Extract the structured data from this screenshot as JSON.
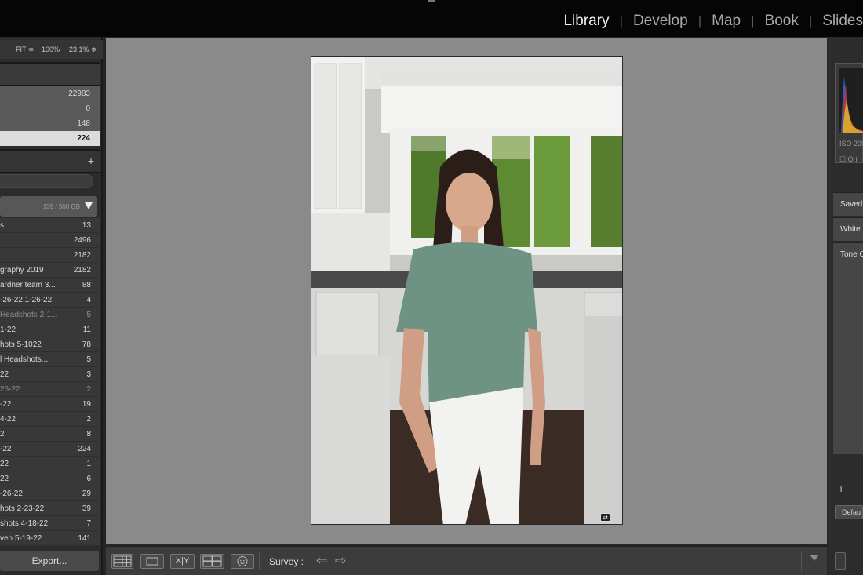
{
  "modules": {
    "items": [
      "Library",
      "Develop",
      "Map",
      "Book",
      "Slides"
    ],
    "active": "Library"
  },
  "navigator": {
    "fit": "FIT ≑",
    "zoom_100": "100%",
    "zoom_custom": "23.1% ≑"
  },
  "catalog": {
    "rows": [
      {
        "count": "22983"
      },
      {
        "count": "0"
      },
      {
        "count": "148"
      },
      {
        "count": "224",
        "selected": true
      }
    ]
  },
  "folders": {
    "add_icon": "+",
    "volume": {
      "size": "139 / 500 GB"
    },
    "rows": [
      {
        "name": "s",
        "count": "13"
      },
      {
        "name": "",
        "count": "2496"
      },
      {
        "name": "",
        "count": "2182"
      },
      {
        "name": "graphy 2019",
        "count": "2182"
      },
      {
        "name": "ardner team 3...",
        "count": "88"
      },
      {
        "name": "-26-22 1-26-22",
        "count": "4"
      },
      {
        "name": "Headshots 2-1...",
        "count": "5",
        "dim": true
      },
      {
        "name": "1-22",
        "count": "11"
      },
      {
        "name": "hots 5-1022",
        "count": "78"
      },
      {
        "name": "l Headshots...",
        "count": "5"
      },
      {
        "name": "22",
        "count": "3"
      },
      {
        "name": "26-22",
        "count": "2",
        "dim": true
      },
      {
        "name": "-22",
        "count": "19"
      },
      {
        "name": "4-22",
        "count": "2"
      },
      {
        "name": "2",
        "count": "8"
      },
      {
        "name": "-22",
        "count": "224"
      },
      {
        "name": "22",
        "count": "1"
      },
      {
        "name": "22",
        "count": "6"
      },
      {
        "name": "-26-22",
        "count": "29"
      },
      {
        "name": "hots 2-23-22",
        "count": "39"
      },
      {
        "name": "shots 4-18-22",
        "count": "7"
      },
      {
        "name": "ven 5-19-22",
        "count": "141"
      }
    ]
  },
  "left_footer": {
    "export_label": "Export..."
  },
  "toolbar": {
    "survey_label": "Survey :",
    "compare_label": "X|Y",
    "icons": [
      "grid-view-icon",
      "loupe-view-icon",
      "compare-view-icon",
      "survey-view-icon",
      "people-view-icon",
      "arrow-left-icon",
      "arrow-right-icon",
      "chevron-down-icon"
    ]
  },
  "right_panel": {
    "iso_text": "ISO 200",
    "original_text": "Ori",
    "quick_develop": [
      "Saved",
      "White",
      "Tone C"
    ],
    "plus": "+",
    "default_label": "Defau"
  }
}
